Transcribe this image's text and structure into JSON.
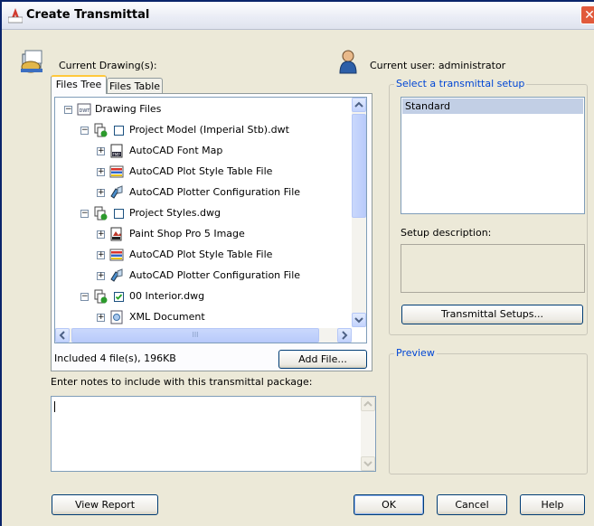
{
  "window": {
    "title": "Create Transmittal",
    "close_glyph": "✕",
    "colors": {
      "title_accent": "#0a246a",
      "group_label": "#0046d5",
      "selection": "#c2cfe5",
      "face": "#ece9d8"
    }
  },
  "header": {
    "current_drawings_label": "Current Drawing(s):",
    "current_user_label": "Current user: administrator"
  },
  "tabs": [
    {
      "label": "Files Tree",
      "active": true
    },
    {
      "label": "Files Table",
      "active": false
    }
  ],
  "tree": {
    "root": "Drawing Files",
    "items": [
      {
        "label": "Project Model (Imperial Stb).dwt",
        "checked": false,
        "icon": "drawing-icon"
      },
      {
        "label": "AutoCAD Font Map",
        "icon": "font-map-icon"
      },
      {
        "label": "AutoCAD Plot Style Table File",
        "icon": "plot-style-icon"
      },
      {
        "label": "AutoCAD Plotter Configuration File",
        "icon": "plotter-icon"
      },
      {
        "label": "Project Styles.dwg",
        "checked": false,
        "icon": "drawing-icon"
      },
      {
        "label": "Paint Shop Pro 5 Image",
        "icon": "image-icon"
      },
      {
        "label": "AutoCAD Plot Style Table File",
        "icon": "plot-style-icon"
      },
      {
        "label": "AutoCAD Plotter Configuration File",
        "icon": "plotter-icon"
      },
      {
        "label": "00 Interior.dwg",
        "checked": true,
        "icon": "drawing-icon"
      },
      {
        "label": "XML Document",
        "icon": "xml-icon"
      }
    ],
    "hscroll_grip": "III"
  },
  "footer": {
    "included_text": "Included 4 file(s), 196KB",
    "add_file_button": "Add File..."
  },
  "notes": {
    "label": "Enter notes to include with this transmittal package:",
    "value": ""
  },
  "setup": {
    "group_label": "Select a transmittal setup",
    "items": [
      {
        "label": "Standard",
        "selected": true
      }
    ],
    "description_label": "Setup description:",
    "description_value": "",
    "setups_button": "Transmittal Setups..."
  },
  "preview": {
    "group_label": "Preview"
  },
  "buttons": {
    "view_report": "View Report",
    "ok": "OK",
    "cancel": "Cancel",
    "help": "Help"
  }
}
